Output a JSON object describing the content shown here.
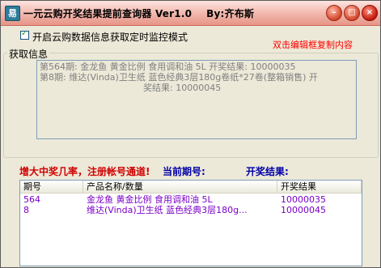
{
  "window": {
    "title": "一元云购开奖结果提前查询器 Ver1.0",
    "author": "By:齐布斯"
  },
  "titlebar_buttons": {
    "minimize": "–",
    "maximize": "□",
    "close": "×"
  },
  "monitor": {
    "checkbox_label": "开启云购数据信息获取定时监控模式",
    "checked": true
  },
  "hint": "双击编辑框复制内容",
  "fetch_group": {
    "title": "获取信息",
    "lines": [
      "第564期: 金龙鱼 黄金比例 食用调和油 5L   开奖结果: 10000035",
      "第8期: 维达(Vinda)卫生纸 蓝色经典3层180g卷纸*27卷(整箱销售)   开",
      "奖结果: 10000045"
    ]
  },
  "status": {
    "promo": "增大中奖几率，注册帐号通道!",
    "current_issue_label": "当前期号:",
    "result_label": "开奖结果:"
  },
  "table": {
    "columns": [
      "期号",
      "产品名称/数量",
      "开奖结果"
    ],
    "rows": [
      {
        "issue": "564",
        "product": "金龙鱼 黄金比例 食用调和油 5L",
        "result": "10000035"
      },
      {
        "issue": "8",
        "product": "维达(Vinda)卫生纸 蓝色经典3层180g...",
        "result": "10000045"
      }
    ],
    "row_color": "#7a00c8"
  },
  "colors": {
    "titlebar": "#f3bdb4",
    "hint": "#ff0000",
    "promo": "#d10000",
    "labels": "#0000a8"
  }
}
